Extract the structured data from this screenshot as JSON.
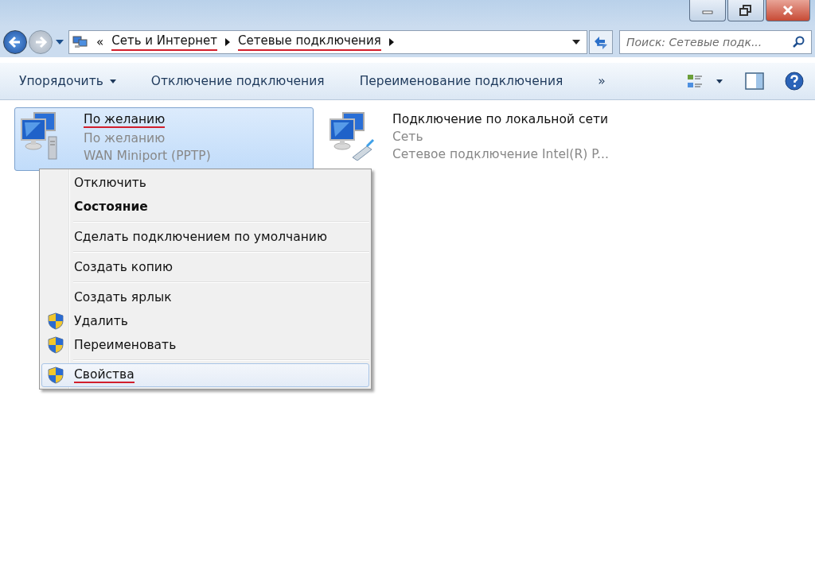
{
  "address": {
    "overflow": "«",
    "crumbs": [
      {
        "label": "Сеть и Интернет",
        "underlined": true
      },
      {
        "label": "Сетевые подключения",
        "underlined": true
      }
    ]
  },
  "search": {
    "placeholder": "Поиск: Сетевые подк..."
  },
  "toolbar": {
    "items": [
      {
        "label": "Упорядочить",
        "dropdown": true
      },
      {
        "label": "Отключение подключения",
        "dropdown": false
      },
      {
        "label": "Переименование подключения",
        "dropdown": false
      }
    ],
    "more": "»"
  },
  "connections": [
    {
      "title": "По желанию",
      "status": "По желанию",
      "device": "WAN Miniport (PPTP)",
      "selected": true,
      "underlined": true,
      "kind": "vpn"
    },
    {
      "title": "Подключение по локальной сети",
      "status": "Сеть",
      "device": "Сетевое подключение Intel(R) P...",
      "selected": false,
      "underlined": false,
      "kind": "lan"
    }
  ],
  "context_menu": [
    {
      "kind": "item",
      "label": "Отключить",
      "bold": false,
      "shield": false,
      "selected": false,
      "underlined": false
    },
    {
      "kind": "item",
      "label": "Состояние",
      "bold": true,
      "shield": false,
      "selected": false,
      "underlined": false
    },
    {
      "kind": "separator"
    },
    {
      "kind": "item",
      "label": "Сделать подключением по умолчанию",
      "bold": false,
      "shield": false,
      "selected": false,
      "underlined": false
    },
    {
      "kind": "separator"
    },
    {
      "kind": "item",
      "label": "Создать копию",
      "bold": false,
      "shield": false,
      "selected": false,
      "underlined": false
    },
    {
      "kind": "separator"
    },
    {
      "kind": "item",
      "label": "Создать ярлык",
      "bold": false,
      "shield": false,
      "selected": false,
      "underlined": false
    },
    {
      "kind": "item",
      "label": "Удалить",
      "bold": false,
      "shield": true,
      "selected": false,
      "underlined": false
    },
    {
      "kind": "item",
      "label": "Переименовать",
      "bold": false,
      "shield": true,
      "selected": false,
      "underlined": false
    },
    {
      "kind": "separator"
    },
    {
      "kind": "item",
      "label": "Свойства",
      "bold": false,
      "shield": true,
      "selected": true,
      "underlined": true
    }
  ]
}
